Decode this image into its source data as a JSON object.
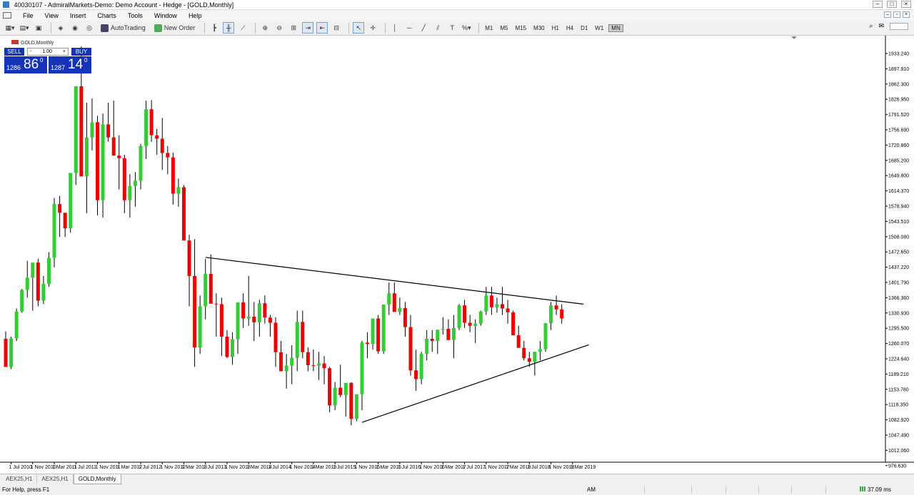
{
  "window": {
    "title": "40030107 - AdmiralMarkets-Demo: Demo Account - Hedge - [GOLD,Monthly]"
  },
  "menu": {
    "items": [
      "File",
      "View",
      "Insert",
      "Charts",
      "Tools",
      "Window",
      "Help"
    ]
  },
  "toolbar": {
    "autotrading_label": "AutoTrading",
    "new_order_label": "New Order",
    "timeframes": [
      "M1",
      "M5",
      "M15",
      "M30",
      "H1",
      "H4",
      "D1",
      "W1",
      "MN"
    ],
    "active_timeframe": "MN"
  },
  "symbol_label": "GOLD,Monthly",
  "trade_panel": {
    "sell_label": "SELL",
    "buy_label": "BUY",
    "lot_value": "1.00",
    "lot_minus": "-",
    "lot_plus": "+",
    "sell_prefix": "1286",
    "sell_big": "86",
    "sell_sup": "0",
    "buy_prefix": "1287",
    "buy_big": "14",
    "buy_sup": "0"
  },
  "chart_data": {
    "type": "candlestick",
    "symbol": "GOLD",
    "timeframe": "Monthly",
    "colors": {
      "bull": "#33cc33",
      "bear": "#ee0000",
      "wick": "#000000",
      "trendline": "#000000",
      "background": "#ffffff"
    },
    "price_axis_labels": [
      "1933.240",
      "1897.910",
      "1862.300",
      "1826.950",
      "1791.520",
      "1756.690",
      "1720.860",
      "1685.200",
      "1649.800",
      "1614.370",
      "1578.940",
      "1543.510",
      "1508.080",
      "1472.650",
      "1437.220",
      "1401.790",
      "1366.360",
      "1330.930",
      "1295.500",
      "1260.070",
      "1224.640",
      "1189.210",
      "1153.780",
      "1118.350",
      "1082.920",
      "1047.490",
      "1012.060",
      "976.630"
    ],
    "time_axis_labels": [
      "1 Jul 2010",
      "1 Nov 2010",
      "1 Mar 2011",
      "1 Jul 2011",
      "1 Nov 2011",
      "1 Mar 2012",
      "1 Jul 2012",
      "1 Nov 2012",
      "1 Mar 2013",
      "1 Jul 2013",
      "1 Nov 2013",
      "1 Mar 2014",
      "1 Jul 2014",
      "1 Nov 2014",
      "1 Mar 2015",
      "1 Jul 2015",
      "1 Nov 2015",
      "1 Mar 2016",
      "1 Jul 2016",
      "1 Nov 2016",
      "1 Mar 2017",
      "1 Jul 2017",
      "1 Nov 2017",
      "1 Mar 2018",
      "1 Jul 2018",
      "1 Nov 2018",
      "1 Mar 2019"
    ],
    "first_bar": "2010-06",
    "candles": [
      [
        1245,
        1262,
        1180,
        1180
      ],
      [
        1180,
        1250,
        1175,
        1246
      ],
      [
        1246,
        1315,
        1240,
        1308
      ],
      [
        1308,
        1360,
        1305,
        1358
      ],
      [
        1358,
        1425,
        1340,
        1386
      ],
      [
        1386,
        1418,
        1310,
        1421
      ],
      [
        1421,
        1430,
        1320,
        1333
      ],
      [
        1333,
        1390,
        1325,
        1372
      ],
      [
        1372,
        1445,
        1365,
        1432
      ],
      [
        1432,
        1570,
        1410,
        1556
      ],
      [
        1556,
        1575,
        1480,
        1536
      ],
      [
        1536,
        1535,
        1480,
        1500
      ],
      [
        1500,
        1600,
        1490,
        1628
      ],
      [
        1628,
        1802,
        1600,
        1828
      ],
      [
        1828,
        1920,
        1715,
        1620
      ],
      [
        1620,
        1790,
        1535,
        1710
      ],
      [
        1710,
        1800,
        1680,
        1745
      ],
      [
        1745,
        1760,
        1530,
        1565
      ],
      [
        1565,
        1765,
        1525,
        1740
      ],
      [
        1740,
        1790,
        1700,
        1710
      ],
      [
        1710,
        1795,
        1670,
        1668
      ],
      [
        1668,
        1715,
        1590,
        1662
      ],
      [
        1662,
        1670,
        1535,
        1565
      ],
      [
        1565,
        1625,
        1525,
        1598
      ],
      [
        1598,
        1630,
        1550,
        1610
      ],
      [
        1610,
        1695,
        1590,
        1690
      ],
      [
        1690,
        1795,
        1660,
        1775
      ],
      [
        1775,
        1796,
        1700,
        1715
      ],
      [
        1715,
        1730,
        1670,
        1707
      ],
      [
        1707,
        1755,
        1635,
        1674
      ],
      [
        1674,
        1690,
        1625,
        1664
      ],
      [
        1664,
        1675,
        1555,
        1580
      ],
      [
        1580,
        1615,
        1550,
        1595
      ],
      [
        1595,
        1600,
        1520,
        1472
      ],
      [
        1472,
        1485,
        1320,
        1390
      ],
      [
        1390,
        1475,
        1180,
        1225
      ],
      [
        1225,
        1345,
        1210,
        1320
      ],
      [
        1320,
        1430,
        1290,
        1395
      ],
      [
        1395,
        1440,
        1330,
        1326
      ],
      [
        1326,
        1350,
        1250,
        1325
      ],
      [
        1325,
        1340,
        1205,
        1250
      ],
      [
        1250,
        1265,
        1200,
        1203
      ],
      [
        1203,
        1260,
        1185,
        1244
      ],
      [
        1244,
        1300,
        1210,
        1329
      ],
      [
        1329,
        1350,
        1270,
        1292
      ],
      [
        1292,
        1390,
        1275,
        1296
      ],
      [
        1296,
        1330,
        1240,
        1283
      ],
      [
        1283,
        1335,
        1250,
        1327
      ],
      [
        1327,
        1345,
        1280,
        1294
      ],
      [
        1294,
        1300,
        1250,
        1282
      ],
      [
        1282,
        1295,
        1180,
        1214
      ],
      [
        1214,
        1240,
        1180,
        1170
      ],
      [
        1170,
        1210,
        1130,
        1183
      ],
      [
        1183,
        1230,
        1140,
        1201
      ],
      [
        1201,
        1310,
        1170,
        1284
      ],
      [
        1284,
        1310,
        1200,
        1214
      ],
      [
        1214,
        1225,
        1170,
        1184
      ],
      [
        1184,
        1220,
        1170,
        1183
      ],
      [
        1183,
        1215,
        1150,
        1188
      ],
      [
        1188,
        1205,
        1140,
        1177
      ],
      [
        1177,
        1180,
        1075,
        1091
      ],
      [
        1091,
        1145,
        1080,
        1132
      ],
      [
        1132,
        1185,
        1110,
        1115
      ],
      [
        1115,
        1135,
        1065,
        1143
      ],
      [
        1143,
        1145,
        1045,
        1060
      ],
      [
        1060,
        1100,
        1055,
        1117
      ],
      [
        1117,
        1240,
        1080,
        1236
      ],
      [
        1236,
        1260,
        1200,
        1233
      ],
      [
        1233,
        1285,
        1220,
        1292
      ],
      [
        1292,
        1300,
        1210,
        1216
      ],
      [
        1216,
        1300,
        1210,
        1324
      ],
      [
        1324,
        1375,
        1300,
        1350
      ],
      [
        1350,
        1375,
        1310,
        1307
      ],
      [
        1307,
        1340,
        1300,
        1316
      ],
      [
        1316,
        1330,
        1250,
        1272
      ],
      [
        1272,
        1300,
        1160,
        1172
      ],
      [
        1172,
        1220,
        1125,
        1152
      ],
      [
        1152,
        1215,
        1140,
        1210
      ],
      [
        1210,
        1265,
        1195,
        1245
      ],
      [
        1245,
        1265,
        1215,
        1240
      ],
      [
        1240,
        1265,
        1210,
        1266
      ],
      [
        1266,
        1295,
        1255,
        1268
      ],
      [
        1268,
        1290,
        1250,
        1242
      ],
      [
        1242,
        1300,
        1200,
        1270
      ],
      [
        1270,
        1325,
        1265,
        1322
      ],
      [
        1322,
        1335,
        1270,
        1282
      ],
      [
        1282,
        1300,
        1260,
        1275
      ],
      [
        1275,
        1290,
        1235,
        1280
      ],
      [
        1280,
        1310,
        1275,
        1308
      ],
      [
        1308,
        1365,
        1300,
        1345
      ],
      [
        1345,
        1365,
        1300,
        1318
      ],
      [
        1318,
        1340,
        1305,
        1325
      ],
      [
        1325,
        1365,
        1300,
        1315
      ],
      [
        1315,
        1335,
        1280,
        1306
      ],
      [
        1306,
        1310,
        1260,
        1253
      ],
      [
        1253,
        1275,
        1235,
        1224
      ],
      [
        1224,
        1240,
        1195,
        1200
      ],
      [
        1200,
        1215,
        1180,
        1192
      ],
      [
        1192,
        1200,
        1160,
        1215
      ],
      [
        1215,
        1240,
        1195,
        1221
      ],
      [
        1221,
        1270,
        1215,
        1281
      ],
      [
        1281,
        1330,
        1265,
        1322
      ],
      [
        1322,
        1345,
        1300,
        1313
      ],
      [
        1313,
        1325,
        1280,
        1292
      ]
    ],
    "trendlines": [
      {
        "from": [
          "2013-07",
          1433
        ],
        "to": [
          "2019-05",
          1325
        ]
      },
      {
        "from": [
          "2015-12",
          1052
        ],
        "to": [
          "2019-06",
          1231
        ]
      }
    ],
    "ylim": [
      960,
      1945
    ]
  },
  "tabs": {
    "items": [
      "AEX25,H1",
      "AEX25,H1",
      "GOLD,Monthly"
    ],
    "active_index": 2
  },
  "status": {
    "help": "For Help, press F1",
    "mode": "AM",
    "ping": "37.09 ms"
  }
}
